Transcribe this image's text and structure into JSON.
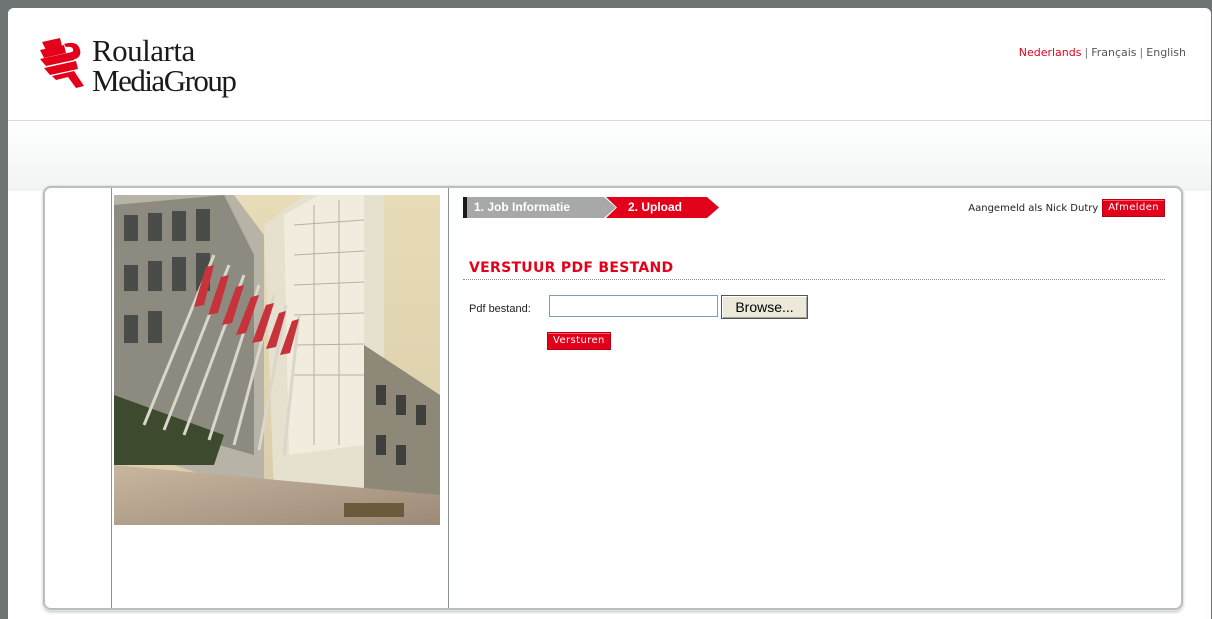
{
  "brand": {
    "line1": "Roularta",
    "line2": "MediaGroup",
    "logo_icon": "roularta-r-icon",
    "accent_color": "#e2001a"
  },
  "languages": [
    {
      "label": "Nederlands",
      "active": true
    },
    {
      "label": "Français",
      "active": false
    },
    {
      "label": "English",
      "active": false
    }
  ],
  "language_separator": "|",
  "steps": [
    {
      "label": "1. Job Informatie",
      "state": "done"
    },
    {
      "label": "2. Upload",
      "state": "active"
    }
  ],
  "user": {
    "logged_in_text": "Aangemeld als Nick Dutry",
    "logout_label": "Afmelden"
  },
  "upload": {
    "title": "VERSTUUR PDF BESTAND",
    "field_label": "Pdf bestand:",
    "file_value": "",
    "browse_label": "Browse...",
    "submit_label": "Versturen"
  }
}
